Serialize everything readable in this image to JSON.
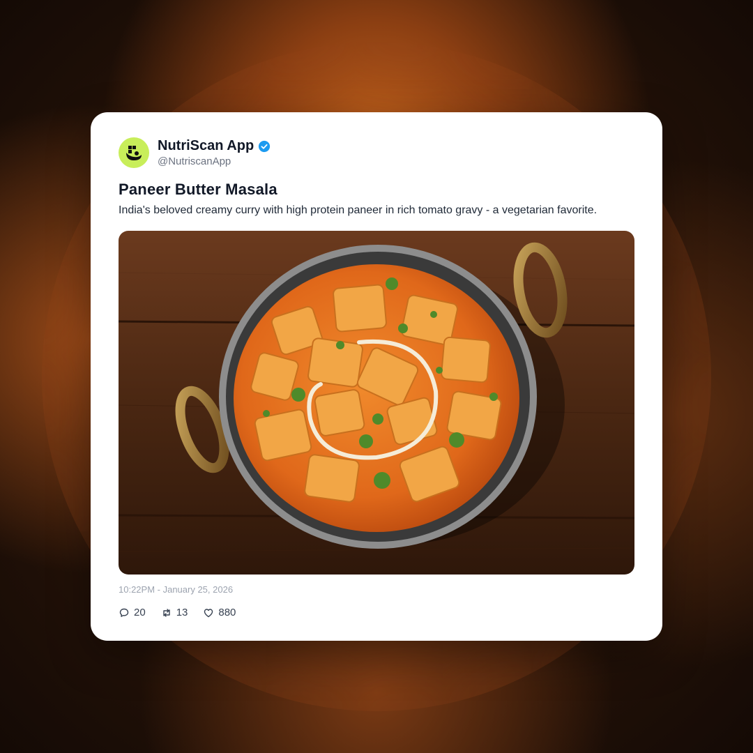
{
  "post": {
    "author": {
      "display_name": "NutriScan App",
      "handle": "@NutriscanApp",
      "verified": true,
      "avatar_color": "#c8ee5a"
    },
    "title": "Paneer Butter Masala",
    "description": "India's beloved creamy curry with high protein paneer in rich tomato gravy - a vegetarian favorite.",
    "timestamp": "10:22PM - January 25, 2026",
    "stats": {
      "replies": "20",
      "reposts": "13",
      "likes": "880"
    }
  },
  "icons": {
    "verified": "verified-badge-icon",
    "reply": "reply-bubble-icon",
    "repost": "repost-arrows-icon",
    "like": "heart-icon"
  },
  "colors": {
    "verified_blue": "#1d9bf0",
    "text_primary": "#111827",
    "text_secondary": "#6b7280"
  }
}
